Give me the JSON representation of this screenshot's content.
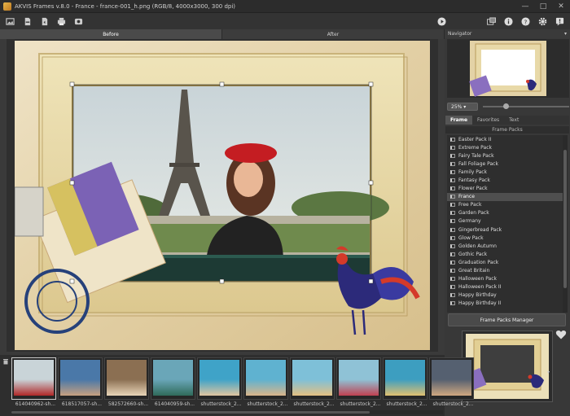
{
  "window": {
    "title": "AKVIS Frames v.8.0 - France - france-001_h.png (RGB/8, 4000x3000, 300 dpi)"
  },
  "view_tabs": {
    "before": "Before",
    "after": "After"
  },
  "navigator": {
    "title": "Navigator",
    "zoom": "25%"
  },
  "frame_tabs": {
    "frame": "Frame",
    "favorites": "Favorites",
    "text": "Text"
  },
  "frame_packs": {
    "header": "Frame Packs",
    "items": [
      "Easter Pack II",
      "Extreme Pack",
      "Fairy Tale Pack",
      "Fall Foliage Pack",
      "Family Pack",
      "Fantasy Pack",
      "Flower Pack",
      "France",
      "Free Pack",
      "Garden Pack",
      "Germany",
      "Gingerbread Pack",
      "Glow Pack",
      "Golden Autumn",
      "Gothic Pack",
      "Graduation Pack",
      "Great Britain",
      "Halloween Pack",
      "Halloween Pack II",
      "Happy Birthday",
      "Happy Birthday II"
    ],
    "selected": "France",
    "manager_button": "Frame Packs Manager"
  },
  "filmstrip": {
    "items": [
      "614040962-sh...",
      "618517057-sh...",
      "582572660-sh...",
      "614040959-sh...",
      "shutterstock_2...",
      "shutterstock_2...",
      "shutterstock_2...",
      "shutterstock_2...",
      "shutterstock_2...",
      "shutterstock_2..."
    ]
  },
  "icons": [
    "app-icon",
    "minimize-icon",
    "maximize-icon",
    "close-icon",
    "open-image-icon",
    "save-icon",
    "export-icon",
    "print-icon",
    "share-icon",
    "run-icon",
    "workspace-icon",
    "info-icon",
    "help-icon",
    "settings-icon",
    "notification-icon",
    "trash-icon",
    "heart-icon",
    "chevron-down-icon"
  ]
}
